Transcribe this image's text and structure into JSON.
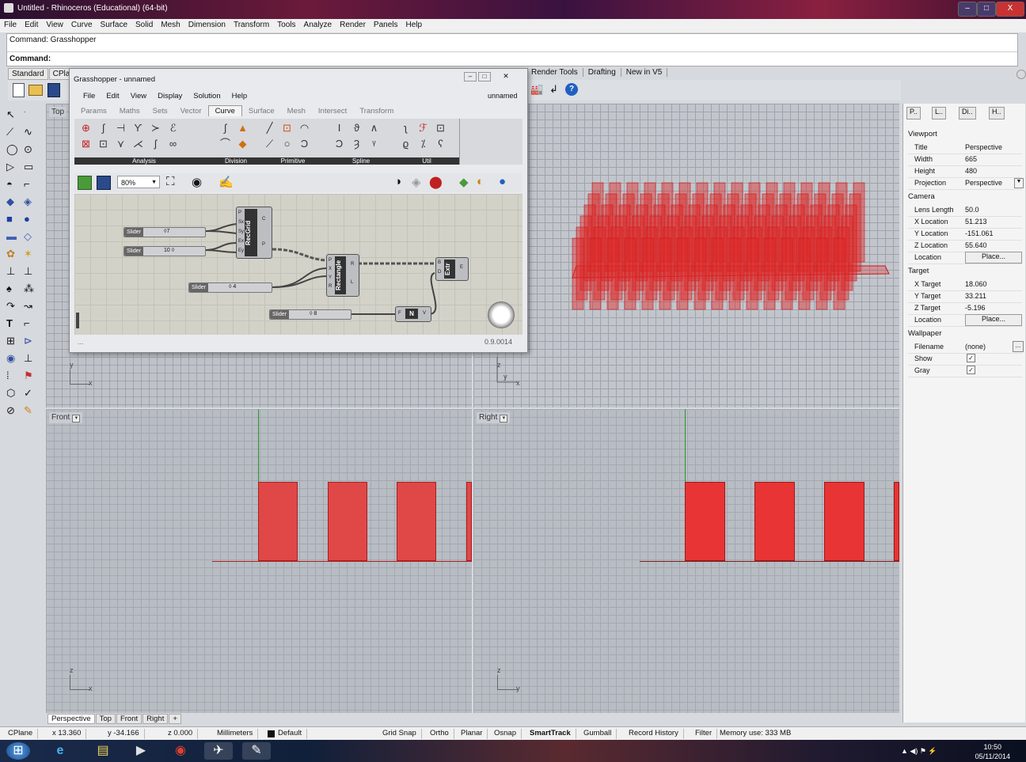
{
  "window": {
    "title": "Untitled - Rhinoceros (Educational) (64-bit)",
    "controls": [
      "–",
      "□",
      "X"
    ]
  },
  "menu": [
    "File",
    "Edit",
    "View",
    "Curve",
    "Surface",
    "Solid",
    "Mesh",
    "Dimension",
    "Transform",
    "Tools",
    "Analyze",
    "Render",
    "Panels",
    "Help"
  ],
  "command": {
    "history": "Command: Grasshopper",
    "prompt": "Command:"
  },
  "toolbar_tabs": [
    "Standard",
    "CPla"
  ],
  "toolbar_tabs_right": [
    "Render Tools",
    "Drafting",
    "New in V5"
  ],
  "viewports": {
    "top": "Top",
    "front": "Front",
    "right": "Right",
    "front_axes": {
      "v": "z",
      "h": "x"
    },
    "right_axes": {
      "v": "z",
      "h": "y"
    },
    "top_axes": {
      "v": "y",
      "h": "x"
    },
    "persp_axes": {
      "v": "z",
      "h": "x",
      "d": "y"
    }
  },
  "viewport_tabs": [
    "Perspective",
    "Top",
    "Front",
    "Right",
    "+"
  ],
  "grasshopper": {
    "title": "Grasshopper - unnamed",
    "doc_name": "unnamed",
    "menu": [
      "File",
      "Edit",
      "View",
      "Display",
      "Solution",
      "Help"
    ],
    "tabs": [
      "Params",
      "Maths",
      "Sets",
      "Vector",
      "Curve",
      "Surface",
      "Mesh",
      "Intersect",
      "Transform"
    ],
    "active_tab": "Curve",
    "groups": [
      "Analysis",
      "Division",
      "Primitive",
      "Spline",
      "Util"
    ],
    "zoom": "80%",
    "version": "0.9.0014",
    "status_left": "...",
    "sliders": [
      {
        "label": "Slider",
        "value": "7"
      },
      {
        "label": "Slider",
        "value": "10"
      },
      {
        "label": "Slider",
        "value": "4"
      },
      {
        "label": "Slider",
        "value": "8"
      }
    ],
    "components": {
      "recgrid": {
        "name": "RecGrid",
        "inputs": [
          "P",
          "Sx",
          "Sy",
          "Ex",
          "Ey"
        ],
        "outputs": [
          "C",
          "P"
        ]
      },
      "rectangle": {
        "name": "Rectangle",
        "inputs": [
          "P",
          "X",
          "Y",
          "R"
        ],
        "outputs": [
          "R",
          "L"
        ]
      },
      "extr": {
        "name": "Extr",
        "inputs": [
          "B",
          "D"
        ],
        "outputs": [
          "E"
        ]
      },
      "unitz": {
        "name": "N",
        "inputs": [
          "F"
        ],
        "outputs": [
          "V"
        ]
      }
    }
  },
  "properties": {
    "tabs": [
      "P..",
      "L..",
      "Di..",
      "H.."
    ],
    "sections": {
      "viewport": "Viewport",
      "camera": "Camera",
      "target": "Target",
      "wallpaper": "Wallpaper"
    },
    "viewport_rows": [
      {
        "k": "Title",
        "v": "Perspective"
      },
      {
        "k": "Width",
        "v": "665"
      },
      {
        "k": "Height",
        "v": "480"
      },
      {
        "k": "Projection",
        "v": "Perspective"
      }
    ],
    "camera_rows": [
      {
        "k": "Lens Length",
        "v": "50.0"
      },
      {
        "k": "X Location",
        "v": "51.213"
      },
      {
        "k": "Y Location",
        "v": "-151.061"
      },
      {
        "k": "Z Location",
        "v": "55.640"
      },
      {
        "k": "Location",
        "v": "Place..."
      }
    ],
    "target_rows": [
      {
        "k": "X Target",
        "v": "18.060"
      },
      {
        "k": "Y Target",
        "v": "33.211"
      },
      {
        "k": "Z Target",
        "v": "-5.196"
      },
      {
        "k": "Location",
        "v": "Place..."
      }
    ],
    "wallpaper_rows": [
      {
        "k": "Filename",
        "v": "(none)"
      },
      {
        "k": "Show",
        "v": "✓"
      },
      {
        "k": "Gray",
        "v": "✓"
      }
    ],
    "browse": "..."
  },
  "status": {
    "cplane": "CPlane",
    "x": "x 13.360",
    "y": "y -34.166",
    "z": "z 0.000",
    "units": "Millimeters",
    "layer": "Default",
    "toggles": [
      "Grid Snap",
      "Ortho",
      "Planar",
      "Osnap",
      "SmartTrack",
      "Gumball",
      "Record History",
      "Filter"
    ],
    "memory": "Memory use: 333 MB"
  },
  "taskbar": {
    "time": "10:50",
    "date": "05/11/2014"
  },
  "colors": {
    "box_red": "#e03030",
    "wire_red": "#c81818"
  }
}
